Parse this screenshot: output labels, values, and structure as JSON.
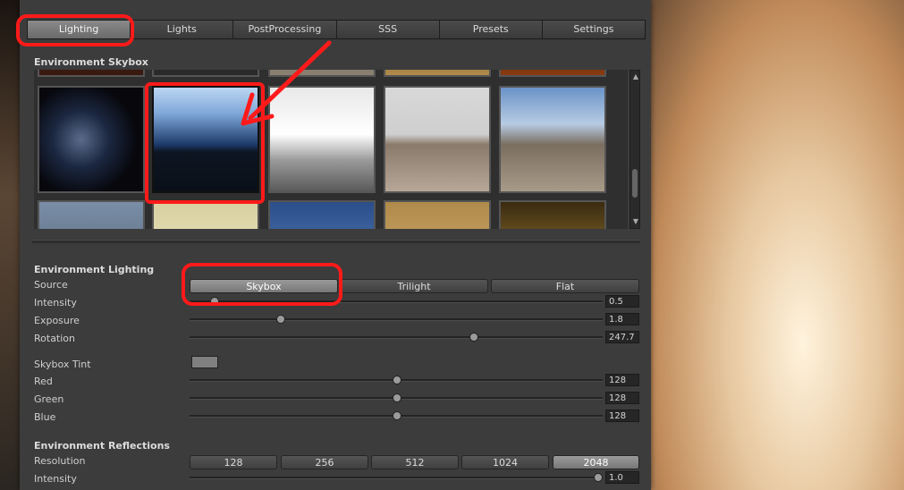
{
  "tabs": [
    {
      "label": "Lighting",
      "active": true
    },
    {
      "label": "Lights",
      "active": false
    },
    {
      "label": "PostProcessing",
      "active": false
    },
    {
      "label": "SSS",
      "active": false
    },
    {
      "label": "Presets",
      "active": false
    },
    {
      "label": "Settings",
      "active": false
    }
  ],
  "skybox": {
    "title": "Environment Skybox"
  },
  "lighting": {
    "title": "Environment Lighting",
    "source_label": "Source",
    "source_options": [
      "Skybox",
      "Trilight",
      "Flat"
    ],
    "source_selected": "Skybox",
    "intensity_label": "Intensity",
    "intensity_value": "0.5",
    "exposure_label": "Exposure",
    "exposure_value": "1.8",
    "rotation_label": "Rotation",
    "rotation_value": "247.7",
    "tint_label": "Skybox Tint",
    "tint_color": "#808080",
    "red_label": "Red",
    "red_value": "128",
    "green_label": "Green",
    "green_value": "128",
    "blue_label": "Blue",
    "blue_value": "128"
  },
  "reflections": {
    "title": "Environment Reflections",
    "resolution_label": "Resolution",
    "resolution_options": [
      "128",
      "256",
      "512",
      "1024",
      "2048"
    ],
    "resolution_selected": "2048",
    "intensity_label": "Intensity",
    "intensity_value": "1.0"
  },
  "annotation_color": "#ff1a1a"
}
